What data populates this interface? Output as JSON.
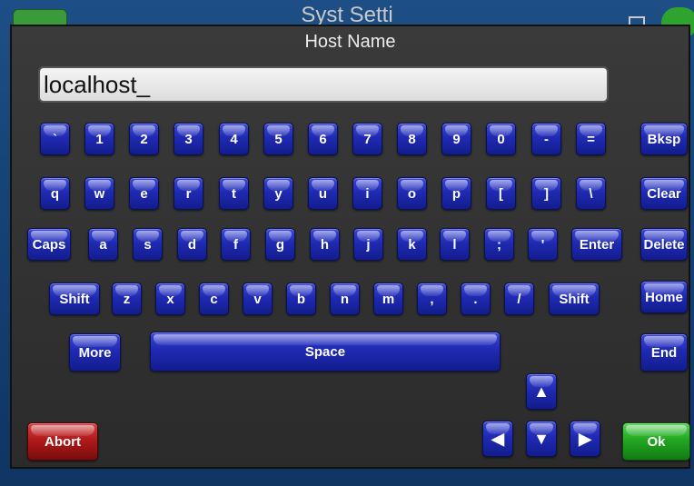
{
  "background": {
    "title": "System Settings",
    "title_visible": "Syst   Setti"
  },
  "dialog": {
    "title": "Host Name",
    "input_value": "localhost_"
  },
  "keyboard": {
    "row1": [
      "`",
      "1",
      "2",
      "3",
      "4",
      "5",
      "6",
      "7",
      "8",
      "9",
      "0",
      "-",
      "="
    ],
    "row2": [
      "q",
      "w",
      "e",
      "r",
      "t",
      "y",
      "u",
      "i",
      "o",
      "p",
      "[",
      "]",
      "\\"
    ],
    "row3": [
      "a",
      "s",
      "d",
      "f",
      "g",
      "h",
      "j",
      "k",
      "l",
      ";",
      "'"
    ],
    "row4": [
      "z",
      "x",
      "c",
      "v",
      "b",
      "n",
      "m",
      ",",
      ".",
      "/"
    ],
    "caps": "Caps",
    "enter": "Enter",
    "shift": "Shift",
    "more": "More",
    "space": "Space"
  },
  "side": {
    "bksp": "Bksp",
    "clear": "Clear",
    "delete": "Delete",
    "home": "Home",
    "end": "End"
  },
  "arrows": {
    "up": "▲",
    "left": "◀",
    "down": "▼",
    "right": "▶"
  },
  "actions": {
    "abort": "Abort",
    "ok": "Ok"
  },
  "colors": {
    "key_blue": "#1f2ab3",
    "abort_red": "#b21a1a",
    "ok_green": "#22a822",
    "dialog_bg": "#2f2f2f"
  }
}
